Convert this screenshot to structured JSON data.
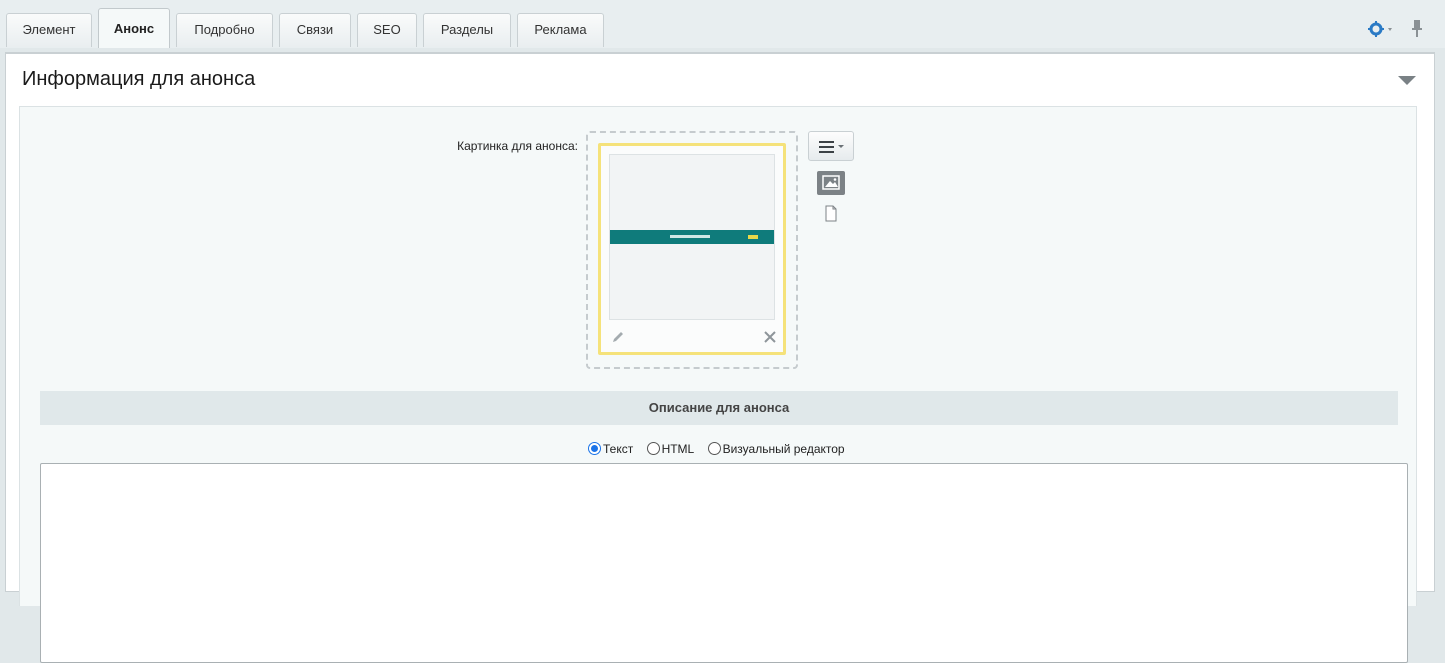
{
  "tabs": [
    {
      "label": "Элемент",
      "active": false
    },
    {
      "label": "Анонс",
      "active": true
    },
    {
      "label": "Подробно",
      "active": false
    },
    {
      "label": "Связи",
      "active": false
    },
    {
      "label": "SEO",
      "active": false
    },
    {
      "label": "Разделы",
      "active": false
    },
    {
      "label": "Реклама",
      "active": false
    }
  ],
  "toolbar": {
    "settings_icon": "gear-icon",
    "pin_icon": "pin-icon",
    "accent": "#2a7ac5"
  },
  "section": {
    "title": "Информация для анонса"
  },
  "picture_field": {
    "label": "Картинка для анонса:",
    "frame_color": "#f5e27a",
    "banner_color": "#0f7b7b"
  },
  "description": {
    "header": "Описание для анонса",
    "format_options": [
      {
        "label": "Текст",
        "checked": true
      },
      {
        "label": "HTML",
        "checked": false
      },
      {
        "label": "Визуальный редактор",
        "checked": false
      }
    ],
    "value": ""
  }
}
